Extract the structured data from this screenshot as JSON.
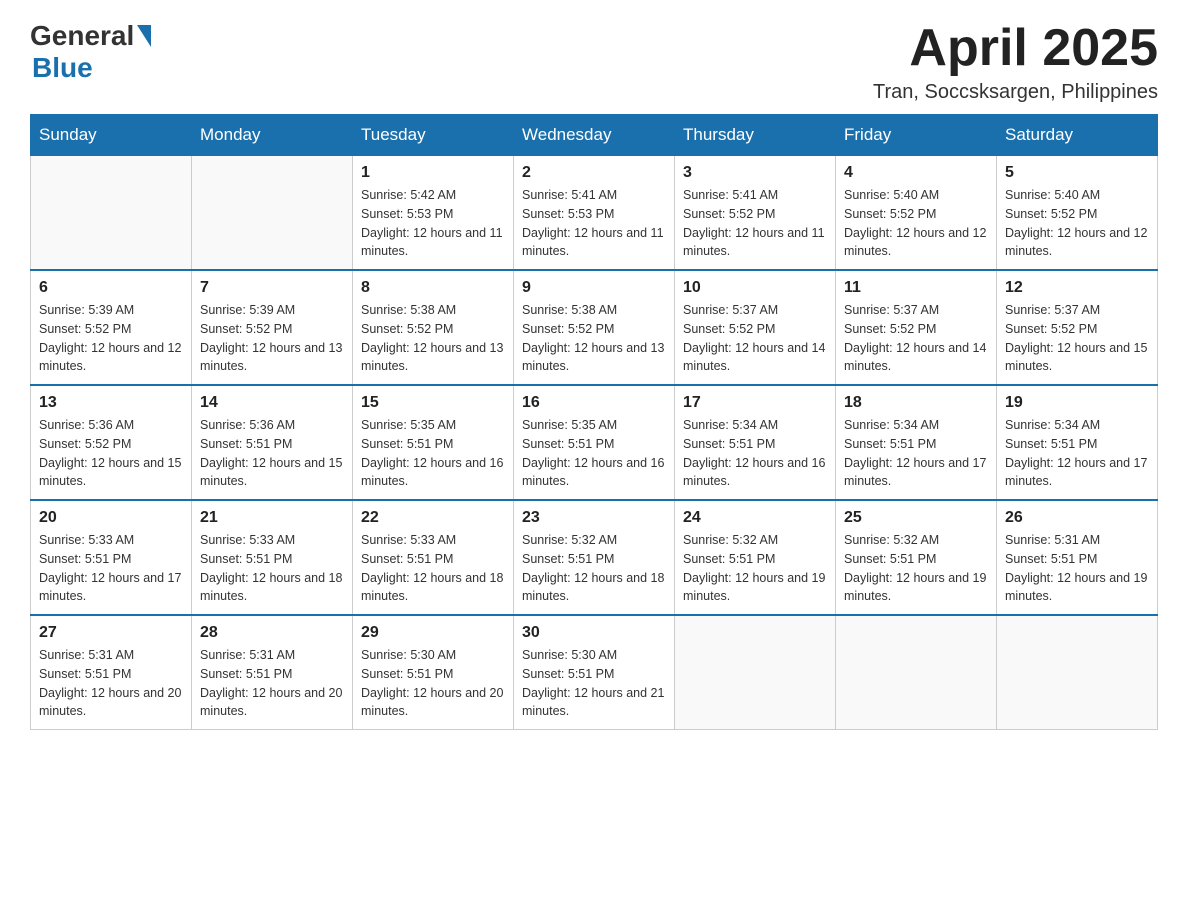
{
  "header": {
    "logo_general": "General",
    "logo_blue": "Blue",
    "month_year": "April 2025",
    "location": "Tran, Soccsksargen, Philippines"
  },
  "days_of_week": [
    "Sunday",
    "Monday",
    "Tuesday",
    "Wednesday",
    "Thursday",
    "Friday",
    "Saturday"
  ],
  "weeks": [
    [
      {
        "day": "",
        "sunrise": "",
        "sunset": "",
        "daylight": ""
      },
      {
        "day": "",
        "sunrise": "",
        "sunset": "",
        "daylight": ""
      },
      {
        "day": "1",
        "sunrise": "Sunrise: 5:42 AM",
        "sunset": "Sunset: 5:53 PM",
        "daylight": "Daylight: 12 hours and 11 minutes."
      },
      {
        "day": "2",
        "sunrise": "Sunrise: 5:41 AM",
        "sunset": "Sunset: 5:53 PM",
        "daylight": "Daylight: 12 hours and 11 minutes."
      },
      {
        "day": "3",
        "sunrise": "Sunrise: 5:41 AM",
        "sunset": "Sunset: 5:52 PM",
        "daylight": "Daylight: 12 hours and 11 minutes."
      },
      {
        "day": "4",
        "sunrise": "Sunrise: 5:40 AM",
        "sunset": "Sunset: 5:52 PM",
        "daylight": "Daylight: 12 hours and 12 minutes."
      },
      {
        "day": "5",
        "sunrise": "Sunrise: 5:40 AM",
        "sunset": "Sunset: 5:52 PM",
        "daylight": "Daylight: 12 hours and 12 minutes."
      }
    ],
    [
      {
        "day": "6",
        "sunrise": "Sunrise: 5:39 AM",
        "sunset": "Sunset: 5:52 PM",
        "daylight": "Daylight: 12 hours and 12 minutes."
      },
      {
        "day": "7",
        "sunrise": "Sunrise: 5:39 AM",
        "sunset": "Sunset: 5:52 PM",
        "daylight": "Daylight: 12 hours and 13 minutes."
      },
      {
        "day": "8",
        "sunrise": "Sunrise: 5:38 AM",
        "sunset": "Sunset: 5:52 PM",
        "daylight": "Daylight: 12 hours and 13 minutes."
      },
      {
        "day": "9",
        "sunrise": "Sunrise: 5:38 AM",
        "sunset": "Sunset: 5:52 PM",
        "daylight": "Daylight: 12 hours and 13 minutes."
      },
      {
        "day": "10",
        "sunrise": "Sunrise: 5:37 AM",
        "sunset": "Sunset: 5:52 PM",
        "daylight": "Daylight: 12 hours and 14 minutes."
      },
      {
        "day": "11",
        "sunrise": "Sunrise: 5:37 AM",
        "sunset": "Sunset: 5:52 PM",
        "daylight": "Daylight: 12 hours and 14 minutes."
      },
      {
        "day": "12",
        "sunrise": "Sunrise: 5:37 AM",
        "sunset": "Sunset: 5:52 PM",
        "daylight": "Daylight: 12 hours and 15 minutes."
      }
    ],
    [
      {
        "day": "13",
        "sunrise": "Sunrise: 5:36 AM",
        "sunset": "Sunset: 5:52 PM",
        "daylight": "Daylight: 12 hours and 15 minutes."
      },
      {
        "day": "14",
        "sunrise": "Sunrise: 5:36 AM",
        "sunset": "Sunset: 5:51 PM",
        "daylight": "Daylight: 12 hours and 15 minutes."
      },
      {
        "day": "15",
        "sunrise": "Sunrise: 5:35 AM",
        "sunset": "Sunset: 5:51 PM",
        "daylight": "Daylight: 12 hours and 16 minutes."
      },
      {
        "day": "16",
        "sunrise": "Sunrise: 5:35 AM",
        "sunset": "Sunset: 5:51 PM",
        "daylight": "Daylight: 12 hours and 16 minutes."
      },
      {
        "day": "17",
        "sunrise": "Sunrise: 5:34 AM",
        "sunset": "Sunset: 5:51 PM",
        "daylight": "Daylight: 12 hours and 16 minutes."
      },
      {
        "day": "18",
        "sunrise": "Sunrise: 5:34 AM",
        "sunset": "Sunset: 5:51 PM",
        "daylight": "Daylight: 12 hours and 17 minutes."
      },
      {
        "day": "19",
        "sunrise": "Sunrise: 5:34 AM",
        "sunset": "Sunset: 5:51 PM",
        "daylight": "Daylight: 12 hours and 17 minutes."
      }
    ],
    [
      {
        "day": "20",
        "sunrise": "Sunrise: 5:33 AM",
        "sunset": "Sunset: 5:51 PM",
        "daylight": "Daylight: 12 hours and 17 minutes."
      },
      {
        "day": "21",
        "sunrise": "Sunrise: 5:33 AM",
        "sunset": "Sunset: 5:51 PM",
        "daylight": "Daylight: 12 hours and 18 minutes."
      },
      {
        "day": "22",
        "sunrise": "Sunrise: 5:33 AM",
        "sunset": "Sunset: 5:51 PM",
        "daylight": "Daylight: 12 hours and 18 minutes."
      },
      {
        "day": "23",
        "sunrise": "Sunrise: 5:32 AM",
        "sunset": "Sunset: 5:51 PM",
        "daylight": "Daylight: 12 hours and 18 minutes."
      },
      {
        "day": "24",
        "sunrise": "Sunrise: 5:32 AM",
        "sunset": "Sunset: 5:51 PM",
        "daylight": "Daylight: 12 hours and 19 minutes."
      },
      {
        "day": "25",
        "sunrise": "Sunrise: 5:32 AM",
        "sunset": "Sunset: 5:51 PM",
        "daylight": "Daylight: 12 hours and 19 minutes."
      },
      {
        "day": "26",
        "sunrise": "Sunrise: 5:31 AM",
        "sunset": "Sunset: 5:51 PM",
        "daylight": "Daylight: 12 hours and 19 minutes."
      }
    ],
    [
      {
        "day": "27",
        "sunrise": "Sunrise: 5:31 AM",
        "sunset": "Sunset: 5:51 PM",
        "daylight": "Daylight: 12 hours and 20 minutes."
      },
      {
        "day": "28",
        "sunrise": "Sunrise: 5:31 AM",
        "sunset": "Sunset: 5:51 PM",
        "daylight": "Daylight: 12 hours and 20 minutes."
      },
      {
        "day": "29",
        "sunrise": "Sunrise: 5:30 AM",
        "sunset": "Sunset: 5:51 PM",
        "daylight": "Daylight: 12 hours and 20 minutes."
      },
      {
        "day": "30",
        "sunrise": "Sunrise: 5:30 AM",
        "sunset": "Sunset: 5:51 PM",
        "daylight": "Daylight: 12 hours and 21 minutes."
      },
      {
        "day": "",
        "sunrise": "",
        "sunset": "",
        "daylight": ""
      },
      {
        "day": "",
        "sunrise": "",
        "sunset": "",
        "daylight": ""
      },
      {
        "day": "",
        "sunrise": "",
        "sunset": "",
        "daylight": ""
      }
    ]
  ]
}
